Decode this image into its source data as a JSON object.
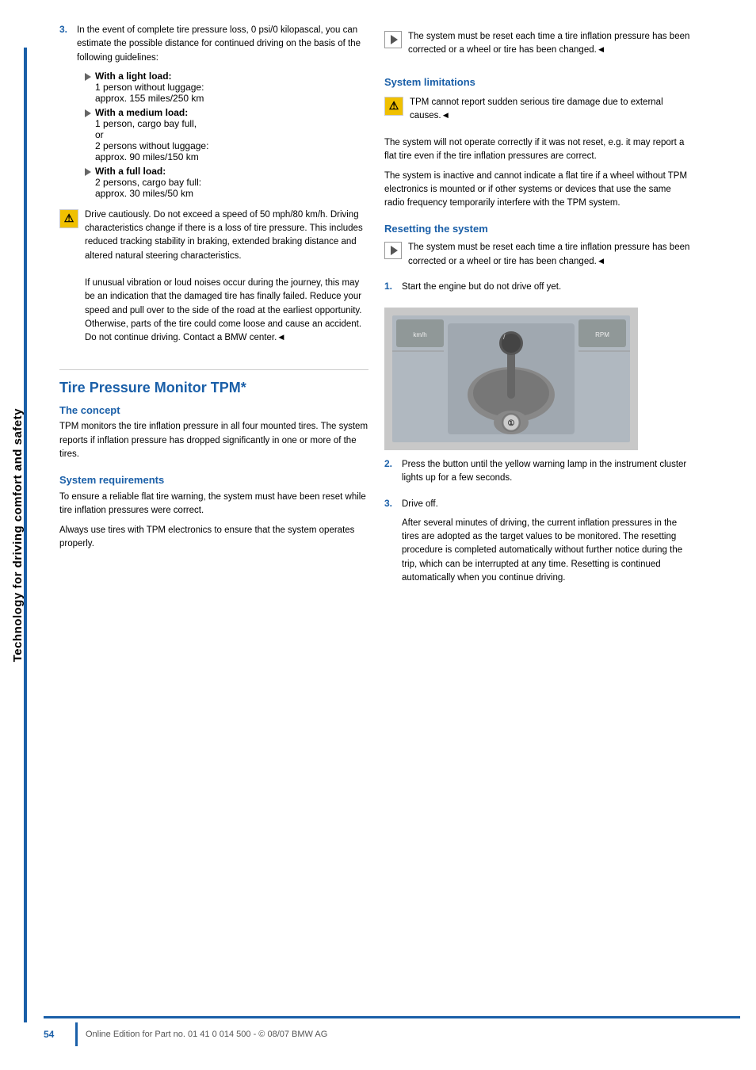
{
  "sidebar": {
    "label": "Technology for driving comfort and safety"
  },
  "left_col": {
    "item3_intro": "In the event of complete tire pressure loss, 0 psi/0 kilopascal, you can estimate the possible distance for continued driving on the basis of the following guidelines:",
    "light_load_title": "With a light load:",
    "light_load_body": "1 person without luggage: approx. 155 miles/250 km",
    "medium_load_title": "With a medium load:",
    "medium_load_body": "1 person, cargo bay full, or\n2 persons without luggage: approx. 90 miles/150 km",
    "full_load_title": "With a full load:",
    "full_load_body": "2 persons, cargo bay full: approx. 30 miles/50 km",
    "warning1": "Drive cautiously. Do not exceed a speed of 50 mph/80 km/h. Driving characteristics change if there is a loss of tire pressure. This includes reduced tracking stability in braking, extended braking distance and altered natural steering characteristics.",
    "warning2": "If unusual vibration or loud noises occur during the journey, this may be an indication that the damaged tire has finally failed. Reduce your speed and pull over to the side of the road at the earliest opportunity. Otherwise, parts of the tire could come loose and cause an accident. Do not continue driving. Contact a BMW center.",
    "main_title": "Tire Pressure Monitor TPM*",
    "concept_heading": "The concept",
    "concept_body": "TPM monitors the tire inflation pressure in all four mounted tires. The system reports if inflation pressure has dropped significantly in one or more of the tires.",
    "sys_req_heading": "System requirements",
    "sys_req_para1": "To ensure a reliable flat tire warning, the system must have been reset while tire inflation pressures were correct.",
    "sys_req_para2": "Always use tires with TPM electronics to ensure that the system operates properly."
  },
  "right_col": {
    "note1_text": "The system must be reset each time a tire inflation pressure has been corrected or a wheel or tire has been changed.",
    "sys_lim_heading": "System limitations",
    "sys_lim_warning": "TPM cannot report sudden serious tire damage due to external causes.",
    "sys_lim_para1": "The system will not operate correctly if it was not reset, e.g. it may report a flat tire even if the tire inflation pressures are correct.",
    "sys_lim_para2": "The system is inactive and cannot indicate a flat tire if a wheel without TPM electronics is mounted or if other systems or devices that use the same radio frequency temporarily interfere with the TPM system.",
    "reset_heading": "Resetting the system",
    "reset_note": "The system must be reset each time a tire inflation pressure has been corrected or a wheel or tire has been changed.",
    "step1": "Start the engine but do not drive off yet.",
    "step2": "Press the button until the yellow warning lamp in the instrument cluster lights up for a few seconds.",
    "step3": "Drive off.",
    "step3_detail": "After several minutes of driving, the current inflation pressures in the tires are adopted as the target values to be monitored. The resetting procedure is completed automatically without further notice during the trip, which can be interrupted at any time. Resetting is continued automatically when you continue driving."
  },
  "footer": {
    "page_num": "54",
    "text": "Online Edition for Part no. 01 41 0 014 500 - © 08/07 BMW AG"
  },
  "end_mark": "◄"
}
